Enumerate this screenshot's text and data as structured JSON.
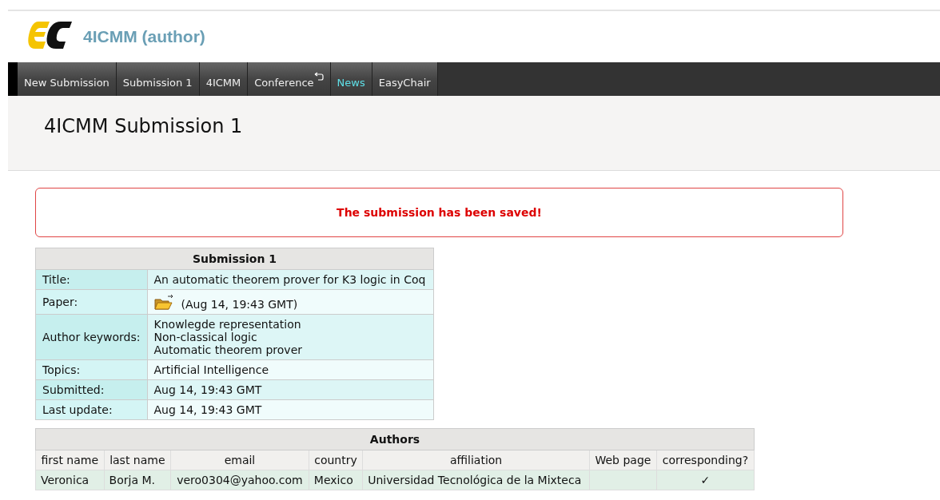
{
  "header": {
    "title": "4ICMM (author)"
  },
  "nav": [
    {
      "label": "New Submission",
      "selected": false,
      "kind": "plain"
    },
    {
      "label": "Submission 1",
      "selected": false,
      "kind": "plain"
    },
    {
      "label": "4ICMM",
      "selected": false,
      "kind": "plain"
    },
    {
      "label": "Conference",
      "selected": false,
      "kind": "return"
    },
    {
      "label": "News",
      "selected": true,
      "kind": "plain"
    },
    {
      "label": "EasyChair",
      "selected": false,
      "kind": "plain"
    }
  ],
  "page_title": "4ICMM Submission 1",
  "alert": "The submission has been saved!",
  "submission": {
    "heading": "Submission 1",
    "rows": [
      {
        "label": "Title:",
        "kind": "text",
        "values": [
          "An automatic theorem prover for K3 logic in Coq"
        ]
      },
      {
        "label": "Paper:",
        "kind": "file",
        "values": [
          "(Aug 14, 19:43 GMT)"
        ]
      },
      {
        "label": "Author keywords:",
        "kind": "text",
        "values": [
          "Knowlegde representation",
          "Non-classical logic",
          "Automatic theorem prover"
        ]
      },
      {
        "label": "Topics:",
        "kind": "text",
        "values": [
          "Artificial Intelligence"
        ]
      },
      {
        "label": "Submitted:",
        "kind": "text",
        "values": [
          "Aug 14, 19:43 GMT"
        ]
      },
      {
        "label": "Last update:",
        "kind": "text",
        "values": [
          "Aug 14, 19:43 GMT"
        ]
      }
    ]
  },
  "authors": {
    "heading": "Authors",
    "columns": [
      "first name",
      "last name",
      "email",
      "country",
      "affiliation",
      "Web page",
      "corresponding?"
    ],
    "rows": [
      [
        "Veronica",
        "Borja M.",
        "vero0304@yahoo.com",
        "Mexico",
        "Universidad Tecnológica de la Mixteca",
        "",
        "✓"
      ]
    ]
  }
}
